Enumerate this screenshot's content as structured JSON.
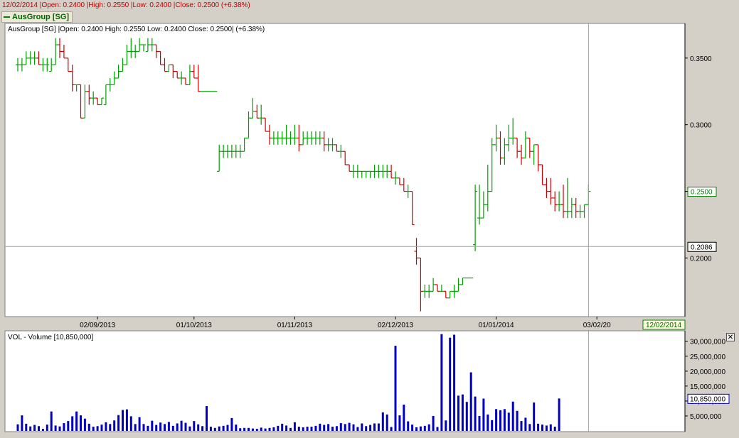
{
  "header": {
    "date": "12/02/2014",
    "open": "|Open: 0.2400",
    "high": "|High: 0.2550",
    "low": "|Low: 0.2400",
    "close": "|Close: 0.2500 (+6.38%)"
  },
  "legend": {
    "label": "AusGroup [SG]",
    "color": "#008000"
  },
  "colors": {
    "up": "#00a000",
    "down": "#d00000",
    "volume": "#0000c0",
    "crosshair": "#999999"
  },
  "main_panel": {
    "info": "AusGroup [SG] |Open: 0.2400 High: 0.2550 Low: 0.2400 Close: 0.2500| (+6.38%)",
    "crosshair_price": "0.2086",
    "last_price": "0.2500",
    "cursor_date": "12/02/2014"
  },
  "volume_panel": {
    "info": "VOL - Volume [10,850,000]",
    "last_value": "10,850,000",
    "close_icon": "close-icon"
  },
  "chart_data": [
    {
      "type": "ohlc",
      "ylim": [
        0.156,
        0.376
      ],
      "y_ticks": [
        "0.3500",
        "0.3000",
        "0.2500",
        "0.2000"
      ],
      "y_tick_values": [
        0.35,
        0.3,
        0.25,
        0.2
      ],
      "x_ticks": [
        "02/09/2013",
        "01/10/2013",
        "01/11/2013",
        "02/12/2013",
        "01/01/2014",
        "03/02/20"
      ],
      "x_tick_bars": [
        19,
        42,
        66,
        90,
        114,
        138
      ],
      "bars": [
        [
          0.345,
          0.35,
          0.34,
          0.345
        ],
        [
          0.345,
          0.35,
          0.34,
          0.345
        ],
        [
          0.345,
          0.355,
          0.345,
          0.35
        ],
        [
          0.35,
          0.355,
          0.345,
          0.35
        ],
        [
          0.35,
          0.355,
          0.345,
          0.35
        ],
        [
          0.35,
          0.355,
          0.345,
          0.345
        ],
        [
          0.345,
          0.35,
          0.34,
          0.345
        ],
        [
          0.345,
          0.35,
          0.34,
          0.345
        ],
        [
          0.34,
          0.35,
          0.34,
          0.345
        ],
        [
          0.345,
          0.365,
          0.345,
          0.36
        ],
        [
          0.36,
          0.365,
          0.35,
          0.355
        ],
        [
          0.355,
          0.36,
          0.35,
          0.35
        ],
        [
          0.35,
          0.35,
          0.34,
          0.34
        ],
        [
          0.34,
          0.345,
          0.325,
          0.33
        ],
        [
          0.33,
          0.33,
          0.325,
          0.33
        ],
        [
          0.33,
          0.33,
          0.305,
          0.305
        ],
        [
          0.305,
          0.33,
          0.305,
          0.325
        ],
        [
          0.325,
          0.33,
          0.315,
          0.32
        ],
        [
          0.32,
          0.325,
          0.315,
          0.32
        ],
        [
          0.32,
          0.32,
          0.315,
          0.315
        ],
        [
          0.315,
          0.32,
          0.315,
          0.32
        ],
        [
          0.315,
          0.33,
          0.315,
          0.33
        ],
        [
          0.33,
          0.335,
          0.325,
          0.33
        ],
        [
          0.33,
          0.34,
          0.33,
          0.335
        ],
        [
          0.335,
          0.345,
          0.335,
          0.34
        ],
        [
          0.34,
          0.35,
          0.34,
          0.345
        ],
        [
          0.345,
          0.36,
          0.345,
          0.355
        ],
        [
          0.355,
          0.365,
          0.35,
          0.355
        ],
        [
          0.355,
          0.36,
          0.35,
          0.355
        ],
        [
          0.355,
          0.365,
          0.355,
          0.36
        ],
        [
          0.36,
          0.36,
          0.355,
          0.36
        ],
        [
          0.355,
          0.365,
          0.355,
          0.36
        ],
        [
          0.36,
          0.365,
          0.355,
          0.36
        ],
        [
          0.36,
          0.36,
          0.35,
          0.355
        ],
        [
          0.355,
          0.355,
          0.345,
          0.345
        ],
        [
          0.345,
          0.35,
          0.34,
          0.34
        ],
        [
          0.34,
          0.345,
          0.34,
          0.345
        ],
        [
          0.345,
          0.345,
          0.335,
          0.34
        ],
        [
          0.34,
          0.34,
          0.335,
          0.335
        ],
        [
          0.335,
          0.34,
          0.33,
          0.335
        ],
        [
          0.335,
          0.335,
          0.33,
          0.33
        ],
        [
          0.33,
          0.345,
          0.33,
          0.34
        ],
        [
          0.34,
          0.345,
          0.335,
          0.335
        ],
        [
          0.335,
          0.345,
          0.325,
          0.325
        ],
        [
          0.325,
          0.325,
          0.325,
          0.325
        ],
        [
          0.325,
          0.325,
          0.325,
          0.325
        ],
        [
          0.325,
          0.325,
          0.325,
          0.325
        ],
        [
          0.325,
          0.325,
          0.325,
          0.325
        ],
        [
          0.265,
          0.285,
          0.265,
          0.28
        ],
        [
          0.28,
          0.285,
          0.275,
          0.28
        ],
        [
          0.28,
          0.285,
          0.275,
          0.28
        ],
        [
          0.28,
          0.285,
          0.275,
          0.28
        ],
        [
          0.28,
          0.285,
          0.275,
          0.28
        ],
        [
          0.28,
          0.285,
          0.275,
          0.28
        ],
        [
          0.28,
          0.29,
          0.28,
          0.29
        ],
        [
          0.29,
          0.31,
          0.29,
          0.305
        ],
        [
          0.305,
          0.32,
          0.305,
          0.31
        ],
        [
          0.31,
          0.315,
          0.305,
          0.305
        ],
        [
          0.305,
          0.315,
          0.3,
          0.305
        ],
        [
          0.305,
          0.305,
          0.295,
          0.295
        ],
        [
          0.295,
          0.3,
          0.285,
          0.29
        ],
        [
          0.29,
          0.295,
          0.285,
          0.29
        ],
        [
          0.29,
          0.295,
          0.285,
          0.29
        ],
        [
          0.29,
          0.295,
          0.285,
          0.29
        ],
        [
          0.29,
          0.3,
          0.285,
          0.29
        ],
        [
          0.29,
          0.295,
          0.285,
          0.29
        ],
        [
          0.29,
          0.3,
          0.285,
          0.29
        ],
        [
          0.29,
          0.3,
          0.28,
          0.285
        ],
        [
          0.285,
          0.295,
          0.285,
          0.29
        ],
        [
          0.29,
          0.295,
          0.285,
          0.29
        ],
        [
          0.29,
          0.295,
          0.285,
          0.29
        ],
        [
          0.29,
          0.295,
          0.285,
          0.29
        ],
        [
          0.29,
          0.295,
          0.285,
          0.29
        ],
        [
          0.29,
          0.295,
          0.28,
          0.285
        ],
        [
          0.285,
          0.29,
          0.28,
          0.285
        ],
        [
          0.285,
          0.29,
          0.28,
          0.285
        ],
        [
          0.285,
          0.285,
          0.28,
          0.28
        ],
        [
          0.28,
          0.285,
          0.275,
          0.28
        ],
        [
          0.28,
          0.28,
          0.27,
          0.27
        ],
        [
          0.27,
          0.27,
          0.265,
          0.265
        ],
        [
          0.265,
          0.27,
          0.26,
          0.265
        ],
        [
          0.265,
          0.27,
          0.26,
          0.265
        ],
        [
          0.265,
          0.265,
          0.26,
          0.265
        ],
        [
          0.265,
          0.265,
          0.26,
          0.265
        ],
        [
          0.265,
          0.265,
          0.26,
          0.265
        ],
        [
          0.265,
          0.27,
          0.26,
          0.265
        ],
        [
          0.265,
          0.27,
          0.26,
          0.265
        ],
        [
          0.265,
          0.27,
          0.26,
          0.265
        ],
        [
          0.265,
          0.27,
          0.26,
          0.265
        ],
        [
          0.265,
          0.27,
          0.26,
          0.26
        ],
        [
          0.26,
          0.265,
          0.255,
          0.26
        ],
        [
          0.26,
          0.26,
          0.255,
          0.255
        ],
        [
          0.255,
          0.26,
          0.25,
          0.25
        ],
        [
          0.25,
          0.255,
          0.245,
          0.25
        ],
        [
          0.25,
          0.25,
          0.225,
          0.225
        ],
        [
          0.205,
          0.215,
          0.195,
          0.2
        ],
        [
          0.2,
          0.2,
          0.16,
          0.175
        ],
        [
          0.175,
          0.18,
          0.17,
          0.175
        ],
        [
          0.175,
          0.18,
          0.17,
          0.175
        ],
        [
          0.175,
          0.185,
          0.175,
          0.18
        ],
        [
          0.18,
          0.18,
          0.175,
          0.175
        ],
        [
          0.175,
          0.18,
          0.175,
          0.175
        ],
        [
          0.175,
          0.175,
          0.17,
          0.17
        ],
        [
          0.17,
          0.175,
          0.17,
          0.175
        ],
        [
          0.175,
          0.18,
          0.17,
          0.175
        ],
        [
          0.175,
          0.185,
          0.175,
          0.18
        ],
        [
          0.18,
          0.185,
          0.18,
          0.185
        ],
        [
          0.185,
          0.185,
          0.185,
          0.185
        ],
        [
          0.185,
          0.185,
          0.185,
          0.185
        ],
        [
          0.21,
          0.255,
          0.205,
          0.25
        ],
        [
          0.23,
          0.255,
          0.225,
          0.23
        ],
        [
          0.23,
          0.25,
          0.23,
          0.24
        ],
        [
          0.24,
          0.27,
          0.235,
          0.25
        ],
        [
          0.25,
          0.29,
          0.25,
          0.285
        ],
        [
          0.285,
          0.3,
          0.28,
          0.29
        ],
        [
          0.29,
          0.295,
          0.27,
          0.275
        ],
        [
          0.275,
          0.29,
          0.27,
          0.285
        ],
        [
          0.285,
          0.3,
          0.28,
          0.29
        ],
        [
          0.29,
          0.305,
          0.285,
          0.29
        ],
        [
          0.29,
          0.29,
          0.275,
          0.28
        ],
        [
          0.28,
          0.285,
          0.27,
          0.275
        ],
        [
          0.275,
          0.295,
          0.275,
          0.29
        ],
        [
          0.29,
          0.29,
          0.275,
          0.28
        ],
        [
          0.28,
          0.285,
          0.27,
          0.285
        ],
        [
          0.285,
          0.285,
          0.265,
          0.27
        ],
        [
          0.27,
          0.27,
          0.255,
          0.255
        ],
        [
          0.255,
          0.26,
          0.245,
          0.25
        ],
        [
          0.25,
          0.26,
          0.24,
          0.245
        ],
        [
          0.245,
          0.25,
          0.235,
          0.24
        ],
        [
          0.24,
          0.25,
          0.235,
          0.24
        ],
        [
          0.24,
          0.255,
          0.23,
          0.235
        ],
        [
          0.235,
          0.26,
          0.23,
          0.235
        ],
        [
          0.235,
          0.245,
          0.23,
          0.24
        ],
        [
          0.24,
          0.245,
          0.23,
          0.235
        ],
        [
          0.235,
          0.24,
          0.23,
          0.235
        ],
        [
          0.235,
          0.24,
          0.23,
          0.24
        ],
        [
          0.24,
          0.255,
          0.24,
          0.25
        ]
      ]
    },
    {
      "type": "bar",
      "title": "VOL - Volume [10,850,000]",
      "ylim": [
        0,
        33500000
      ],
      "y_ticks": [
        "30,000,000",
        "25,000,000",
        "20,000,000",
        "15,000,000",
        "10,000,000",
        "5,000,000"
      ],
      "y_tick_values": [
        30000000,
        25000000,
        20000000,
        15000000,
        10000000,
        5000000
      ],
      "values": [
        2200000,
        5200000,
        2400000,
        1500000,
        2000000,
        1600000,
        700000,
        2100000,
        6500000,
        1800000,
        1500000,
        2600000,
        3300000,
        4900000,
        6500000,
        5200000,
        4100000,
        2400000,
        1400000,
        1600000,
        2100000,
        2900000,
        2300000,
        3500000,
        5300000,
        7000000,
        7200000,
        4900000,
        2300000,
        4600000,
        2300000,
        1700000,
        3400000,
        2000000,
        2800000,
        2300000,
        3000000,
        1700000,
        2500000,
        3400000,
        2700000,
        1500000,
        3300000,
        2200000,
        1600000,
        8300000,
        1400000,
        1000000,
        1500000,
        1700000,
        2000000,
        4300000,
        2100000,
        900000,
        1000000,
        1000000,
        800000,
        700000,
        1100000,
        800000,
        1000000,
        1200000,
        1700000,
        2400000,
        1800000,
        1000000,
        2900000,
        1400000,
        1200000,
        1400000,
        1400000,
        1700000,
        2400000,
        2000000,
        2300000,
        1400000,
        1600000,
        2600000,
        2300000,
        2700000,
        2200000,
        1300000,
        2500000,
        1600000,
        2000000,
        2500000,
        2500000,
        6200000,
        5500000,
        1300000,
        28500000,
        5200000,
        8800000,
        3200000,
        2100000,
        1200000,
        1500000,
        1700000,
        2200000,
        5000000,
        1300000,
        32400000,
        3500000,
        31200000,
        32200000,
        11800000,
        12200000,
        9700000,
        19600000,
        11500000,
        5000000,
        10800000,
        5500000,
        3600000,
        7300000,
        6900000,
        7300000,
        6100000,
        9800000,
        6700000,
        3300000,
        4400000,
        2300000,
        9500000,
        2400000,
        2100000,
        1800000,
        2200000,
        1400000,
        10850000
      ]
    }
  ]
}
